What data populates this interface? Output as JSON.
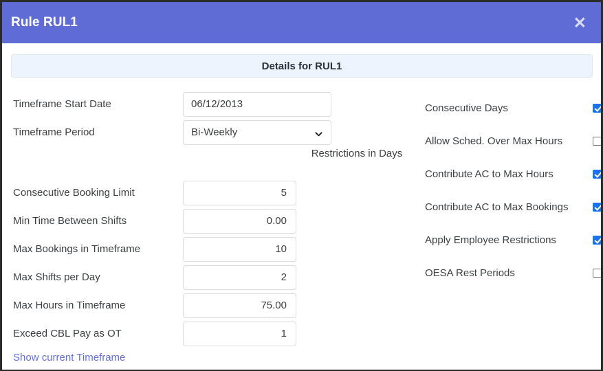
{
  "window": {
    "title": "Rule RUL1",
    "close_icon": "close-icon",
    "header_color": "#606cd6"
  },
  "details_banner": {
    "text": "Details for RUL1",
    "background": "#eef4fd"
  },
  "left": {
    "restrictions_header": "Restrictions in Days",
    "fields": [
      {
        "label": "Timeframe Start Date",
        "value": "06/12/2013",
        "type": "text"
      },
      {
        "label": "Timeframe Period",
        "value": "Bi-Weekly",
        "type": "select",
        "options": [
          "Bi-Weekly"
        ]
      }
    ],
    "numeric_fields": [
      {
        "label": "Consecutive Booking Limit",
        "value": "5",
        "restriction": false
      },
      {
        "label": "Min Time Between Shifts",
        "value": "0.00",
        "restriction": false
      },
      {
        "label": "Max Bookings in Timeframe",
        "value": "10",
        "restriction": false
      },
      {
        "label": "Max Shifts per Day",
        "value": "2",
        "restriction": null
      },
      {
        "label": "Max Hours in Timeframe",
        "value": "75.00",
        "restriction": null
      },
      {
        "label": "Exceed CBL Pay as OT",
        "value": "1",
        "restriction": null
      }
    ],
    "footer_link": "Show current Timeframe"
  },
  "right": {
    "options": [
      {
        "label": "Consecutive Days",
        "checked": true
      },
      {
        "label": "Allow Sched. Over Max Hours",
        "checked": false
      },
      {
        "label": "Contribute AC to Max Hours",
        "checked": true
      },
      {
        "label": "Contribute AC to Max Bookings",
        "checked": true
      },
      {
        "label": "Apply Employee Restrictions",
        "checked": true
      },
      {
        "label": "OESA Rest Periods",
        "checked": false
      }
    ],
    "checked_color": "#1a73e8"
  }
}
